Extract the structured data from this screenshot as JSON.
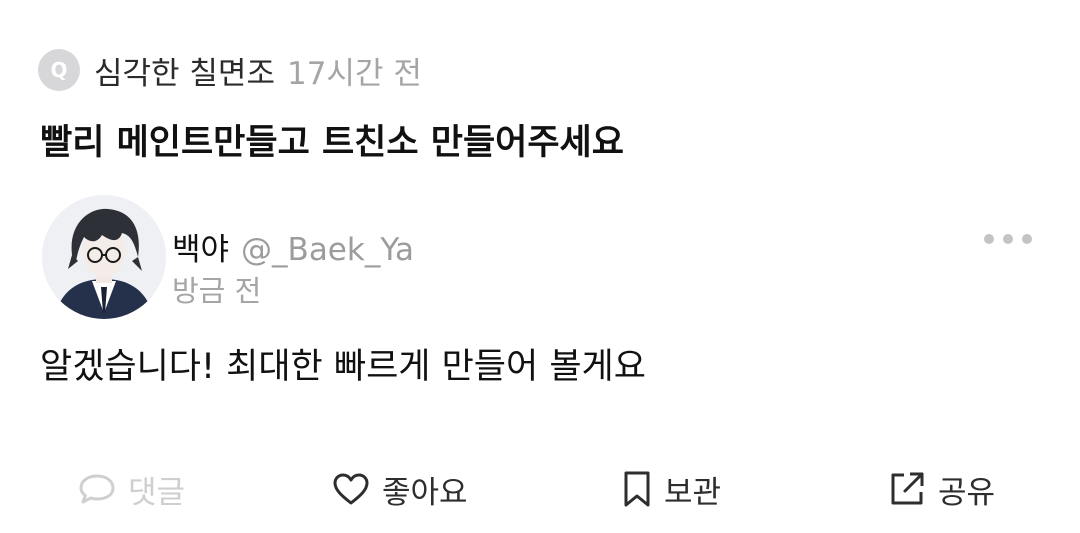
{
  "question": {
    "badge": "Q",
    "author": "심각한 칠면조",
    "time": "17시간 전",
    "text": "빨리 메인트만들고 트친소 만들어주세요"
  },
  "answer": {
    "name": "백야",
    "handle": "@_Baek_Ya",
    "time": "방금 전",
    "text": "알겠습니다! 최대한 빠르게 만들어 볼게요"
  },
  "actions": {
    "comment": "댓글",
    "like": "좋아요",
    "save": "보관",
    "share": "공유"
  },
  "icons": [
    "q-badge-icon",
    "more-dots-icon",
    "comment-bubble-icon",
    "heart-icon",
    "bookmark-icon",
    "share-icon"
  ],
  "colors": {
    "muted": "#a5a5a5",
    "badge": "#d7d7d9",
    "disabled": "#cfcfcf"
  }
}
